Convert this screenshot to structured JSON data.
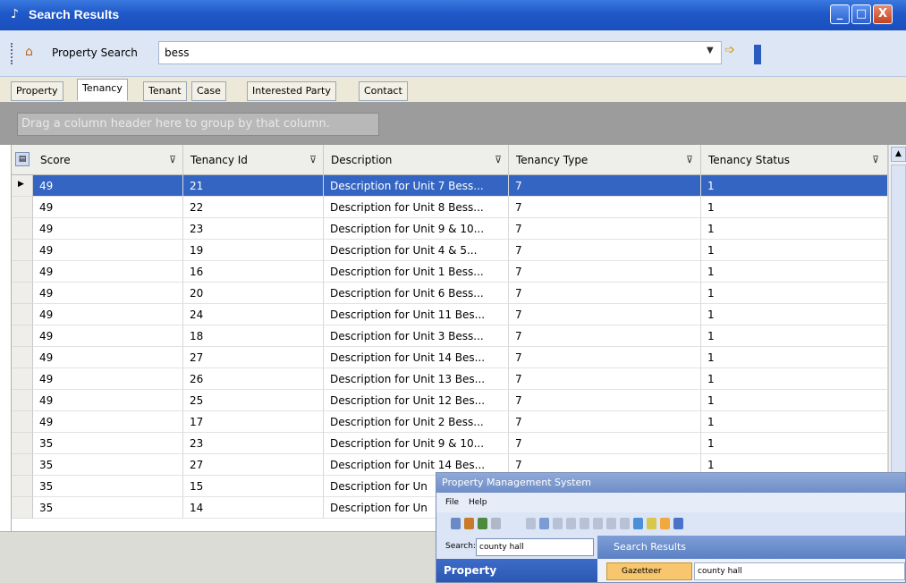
{
  "window": {
    "title": "Search Results",
    "controls": {
      "minimize": "_",
      "maximize": "□",
      "close": "X"
    }
  },
  "search": {
    "label": "Property Search",
    "value": "bess"
  },
  "tabs": [
    {
      "label": "Property"
    },
    {
      "label": "Tenancy",
      "active": true
    },
    {
      "label": "Tenant"
    },
    {
      "label": "Case"
    },
    {
      "label": "Interested Party"
    },
    {
      "label": "Contact"
    }
  ],
  "group_hint": "Drag a column header here to group by that column.",
  "grid": {
    "columns": [
      "Score",
      "Tenancy Id",
      "Description",
      "Tenancy Type",
      "Tenancy Status"
    ],
    "rows": [
      [
        "49",
        "21",
        "Description for Unit 7 Bess...",
        "7",
        "1"
      ],
      [
        "49",
        "22",
        "Description for Unit 8 Bess...",
        "7",
        "1"
      ],
      [
        "49",
        "23",
        "Description for Unit 9 & 10...",
        "7",
        "1"
      ],
      [
        "49",
        "19",
        "Description for Unit 4 & 5...",
        "7",
        "1"
      ],
      [
        "49",
        "16",
        "Description for Unit 1 Bess...",
        "7",
        "1"
      ],
      [
        "49",
        "20",
        "Description for Unit 6 Bess...",
        "7",
        "1"
      ],
      [
        "49",
        "24",
        "Description for Unit 11 Bes...",
        "7",
        "1"
      ],
      [
        "49",
        "18",
        "Description for Unit 3 Bess...",
        "7",
        "1"
      ],
      [
        "49",
        "27",
        "Description for Unit 14 Bes...",
        "7",
        "1"
      ],
      [
        "49",
        "26",
        "Description for Unit 13 Bes...",
        "7",
        "1"
      ],
      [
        "49",
        "25",
        "Description for Unit 12 Bes...",
        "7",
        "1"
      ],
      [
        "49",
        "17",
        "Description for Unit 2 Bess...",
        "7",
        "1"
      ],
      [
        "35",
        "23",
        "Description for Unit 9 & 10...",
        "7",
        "1"
      ],
      [
        "35",
        "27",
        "Description for Unit 14 Bes...",
        "7",
        "1"
      ],
      [
        "35",
        "15",
        "Description for Un",
        "",
        ""
      ],
      [
        "35",
        "14",
        "Description for Un",
        "",
        ""
      ]
    ]
  },
  "inset": {
    "title": "Property Management System",
    "menu": [
      "File",
      "Help"
    ],
    "search_label": "Search:",
    "search_value": "county hall",
    "panel_title": "Property",
    "results_title": "Search Results",
    "gazetteer_label": "Gazetteer Search:",
    "gazetteer_value": "county hall"
  },
  "colors": {
    "selection": "#3465c2",
    "titlebar": "#1f58c8"
  }
}
